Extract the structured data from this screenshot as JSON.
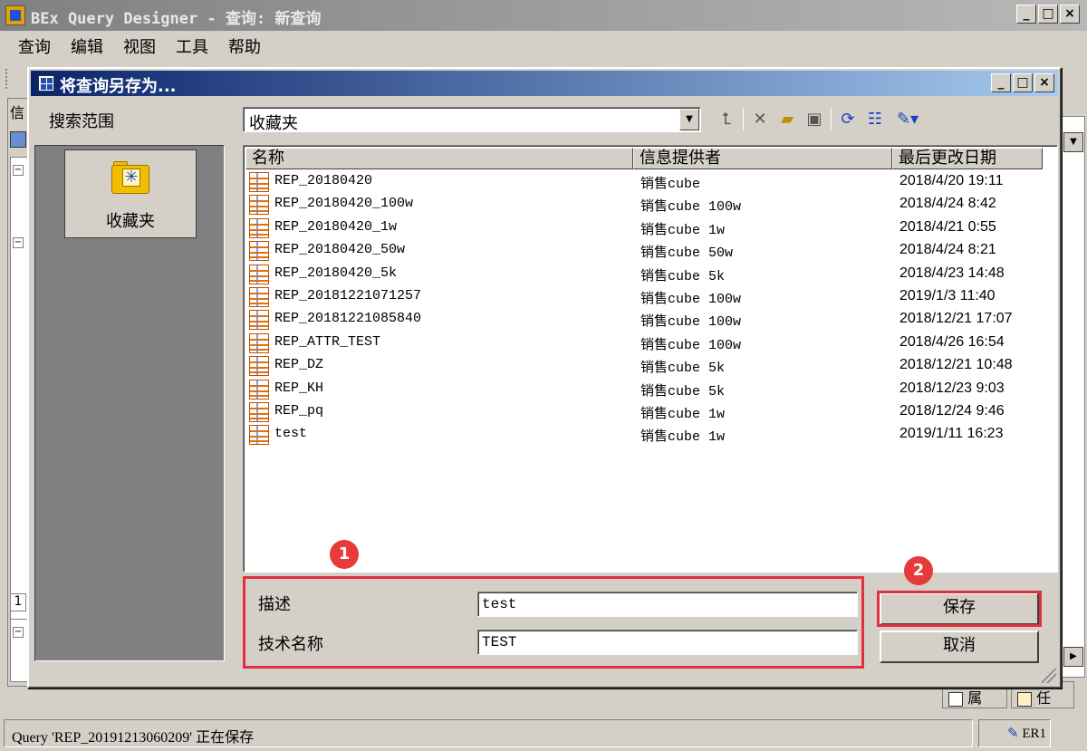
{
  "main_window": {
    "title": "BEx Query Designer - 查询: 新查询",
    "menu": [
      "查询",
      "编辑",
      "视图",
      "工具",
      "帮助"
    ],
    "left_tab_label": "信",
    "left_num": "1"
  },
  "dialog": {
    "title": "将查询另存为...",
    "look_in_label": "搜索范围",
    "look_in_value": "收藏夹",
    "places": [
      {
        "label": "收藏夹",
        "icon": "favorites-folder-icon"
      }
    ],
    "toolbar_icons": [
      "up-folder-icon",
      "delete-icon",
      "new-folder-icon",
      "properties-icon",
      "refresh-icon",
      "details-view-icon",
      "tools-dropdown-icon"
    ],
    "columns": [
      "名称",
      "信息提供者",
      "最后更改日期"
    ],
    "files": [
      {
        "name": "REP_20180420",
        "provider": "销售cube",
        "date": "2018/4/20 19:11"
      },
      {
        "name": "REP_20180420_100w",
        "provider": "销售cube 100w",
        "date": "2018/4/24 8:42"
      },
      {
        "name": "REP_20180420_1w",
        "provider": "销售cube 1w",
        "date": "2018/4/21 0:55"
      },
      {
        "name": "REP_20180420_50w",
        "provider": "销售cube 50w",
        "date": "2018/4/24 8:21"
      },
      {
        "name": "REP_20180420_5k",
        "provider": "销售cube 5k",
        "date": "2018/4/23 14:48"
      },
      {
        "name": "REP_20181221071257",
        "provider": "销售cube 100w",
        "date": "2019/1/3 11:40"
      },
      {
        "name": "REP_20181221085840",
        "provider": "销售cube 100w",
        "date": "2018/12/21 17:07"
      },
      {
        "name": "REP_ATTR_TEST",
        "provider": "销售cube 100w",
        "date": "2018/4/26 16:54"
      },
      {
        "name": "REP_DZ",
        "provider": "销售cube 5k",
        "date": "2018/12/21 10:48"
      },
      {
        "name": "REP_KH",
        "provider": "销售cube 5k",
        "date": "2018/12/23 9:03"
      },
      {
        "name": "REP_pq",
        "provider": "销售cube 1w",
        "date": "2018/12/24 9:46"
      },
      {
        "name": "test",
        "provider": "销售cube 1w",
        "date": "2019/1/11 16:23"
      }
    ],
    "form": {
      "description_label": "描述",
      "description_value": "test",
      "tech_name_label": "技术名称",
      "tech_name_value": "TEST"
    },
    "buttons": {
      "save": "保存",
      "cancel": "取消"
    },
    "annotations": {
      "badge1": "1",
      "badge2": "2",
      "highlight_color": "#e03040"
    }
  },
  "statusbar": {
    "message": "Query 'REP_20191213060209' 正在保存",
    "right": "ER1"
  },
  "bottom_tabs": [
    "属",
    "任"
  ]
}
